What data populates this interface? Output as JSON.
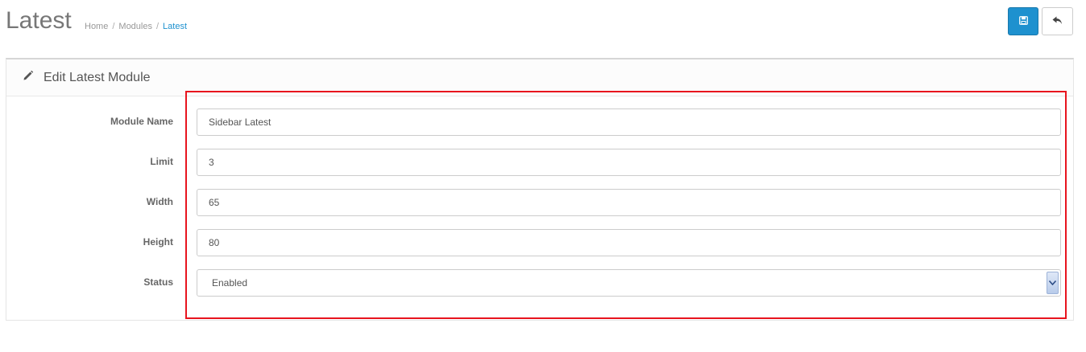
{
  "header": {
    "title": "Latest",
    "breadcrumb": [
      "Home",
      "Modules",
      "Latest"
    ]
  },
  "toolbar": {
    "save_icon": "save-icon",
    "back_icon": "reply-icon",
    "save_color": "#1e91cf"
  },
  "panel": {
    "heading": "Edit Latest Module",
    "heading_icon": "pencil-icon"
  },
  "form": {
    "module_name": {
      "label": "Module Name",
      "value": "Sidebar Latest"
    },
    "limit": {
      "label": "Limit",
      "value": "3"
    },
    "width": {
      "label": "Width",
      "value": "65"
    },
    "height": {
      "label": "Height",
      "value": "80"
    },
    "status": {
      "label": "Status",
      "value": "Enabled"
    }
  },
  "highlight_color": "#e8141e"
}
